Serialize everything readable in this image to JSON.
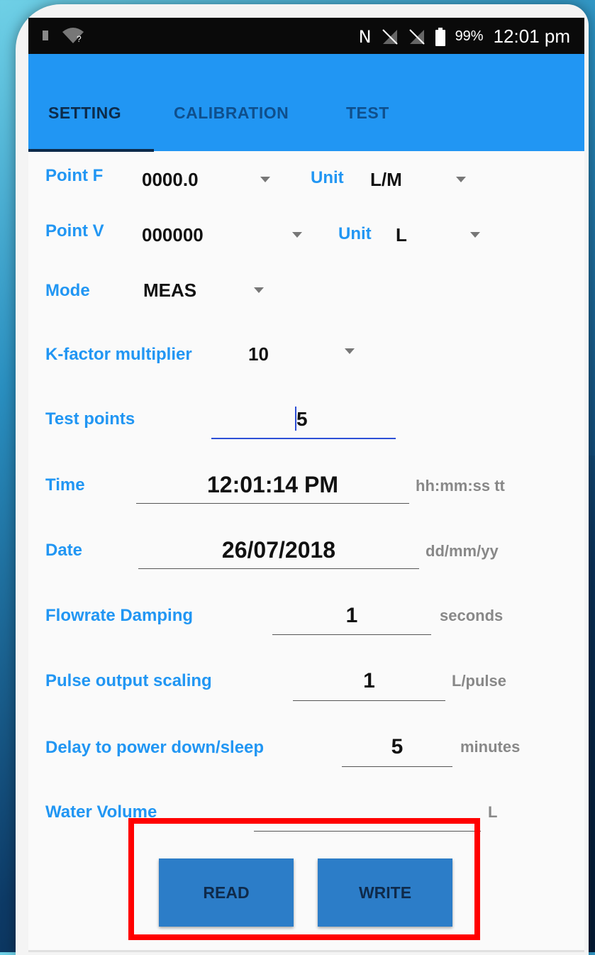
{
  "status_bar": {
    "nfc_icon": "N",
    "battery_percent": "99%",
    "time": "12:01 pm"
  },
  "tabs": [
    "SETTING",
    "CALIBRATION",
    "TEST"
  ],
  "form": {
    "point_f": {
      "label": "Point F",
      "value": "0000.0",
      "unit_label": "Unit",
      "unit_value": "L/M"
    },
    "point_v": {
      "label": "Point V",
      "value": "000000",
      "unit_label": "Unit",
      "unit_value": "L"
    },
    "mode": {
      "label": "Mode",
      "value": "MEAS"
    },
    "k_factor": {
      "label": "K-factor multiplier",
      "value": "10"
    },
    "test_points": {
      "label": "Test points",
      "value": "5"
    },
    "time": {
      "label": "Time",
      "value": "12:01:14 PM",
      "hint": "hh:mm:ss tt"
    },
    "date": {
      "label": "Date",
      "value": "26/07/2018",
      "hint": "dd/mm/yy"
    },
    "flowrate_damping": {
      "label": "Flowrate Damping",
      "value": "1",
      "hint": "seconds"
    },
    "pulse_output_scaling": {
      "label": "Pulse output scaling",
      "value": "1",
      "hint": "L/pulse"
    },
    "delay_power_down": {
      "label": "Delay to power down/sleep",
      "value": "5",
      "hint": "minutes"
    },
    "water_volume": {
      "label": "Water Volume",
      "value": "",
      "hint": "L"
    }
  },
  "buttons": {
    "read": "READ",
    "write": "WRITE"
  },
  "colors": {
    "accent": "#2196f3",
    "highlight": "#ff0000",
    "button": "#2c7dc8"
  }
}
